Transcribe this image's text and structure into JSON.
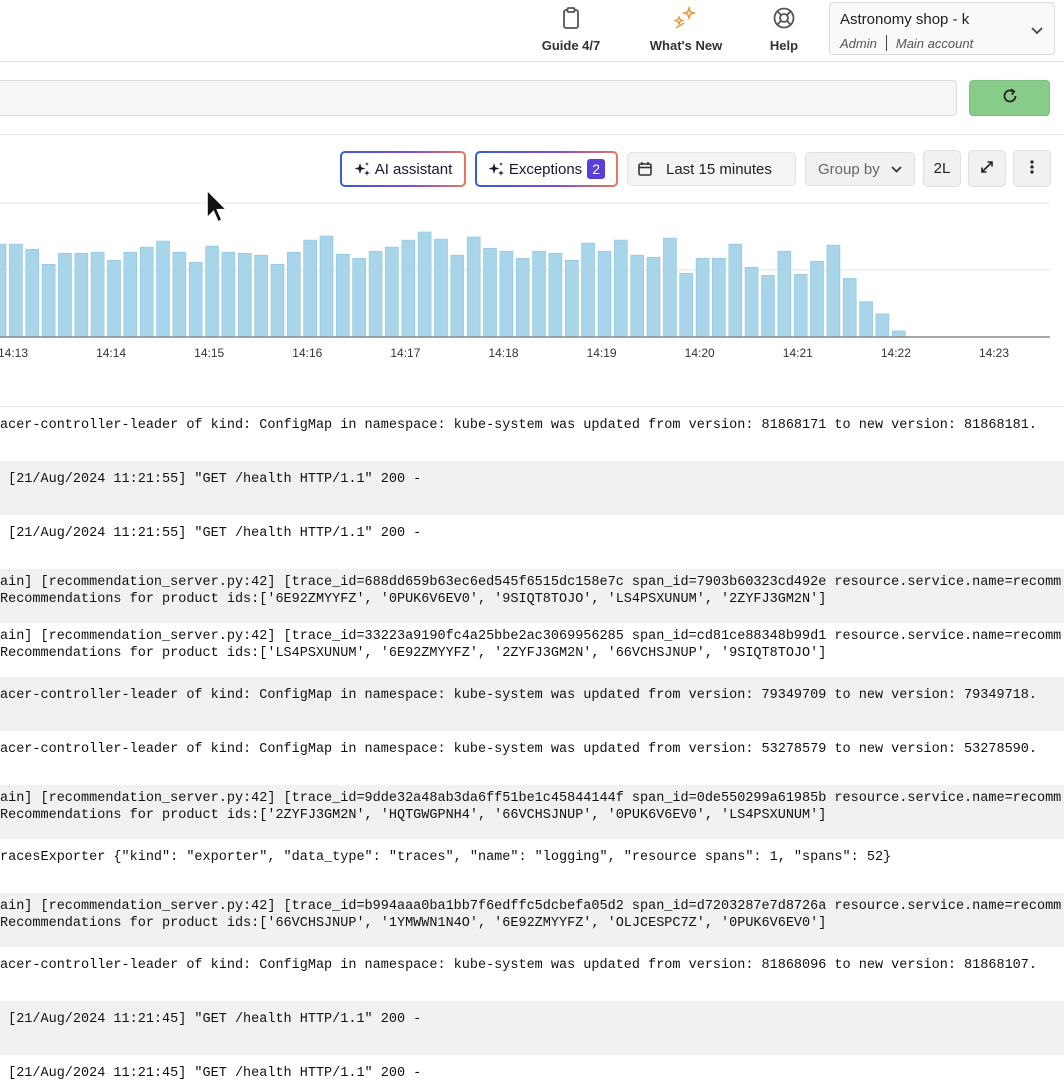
{
  "header": {
    "guide": {
      "label": "Guide 4/7",
      "icon": "clipboard-icon"
    },
    "whats_new": {
      "label": "What's New",
      "icon": "sparkle-stars-icon"
    },
    "help": {
      "label": "Help",
      "icon": "lifebuoy-icon"
    },
    "account": {
      "name": "Astronomy shop - k",
      "role": "Admin",
      "account": "Main account"
    }
  },
  "search": {
    "value": "",
    "refresh_icon": "refresh-icon",
    "refresh_color": "#88cc8a"
  },
  "toolbar": {
    "ai_assistant": "AI assistant",
    "exceptions": "Exceptions",
    "exceptions_count": "2",
    "time_range": "Last 15 minutes",
    "group_by": "Group by",
    "lines_toggle": "2L",
    "expand_icon": "expand-icon",
    "more_icon": "more-vertical-icon"
  },
  "chart_data": {
    "type": "bar",
    "color": "#a8d5ea",
    "x_tick_labels": [
      "14:13",
      "14:14",
      "14:15",
      "14:16",
      "14:17",
      "14:18",
      "14:19",
      "14:20",
      "14:21",
      "14:22",
      "14:23"
    ],
    "values": [
      92,
      92,
      87,
      72,
      83,
      83,
      84,
      76,
      84,
      89,
      95,
      84,
      74,
      90,
      84,
      83,
      81,
      72,
      84,
      96,
      100,
      82,
      78,
      85,
      89,
      96,
      104,
      97,
      81,
      99,
      88,
      85,
      78,
      85,
      83,
      76,
      93,
      85,
      96,
      81,
      79,
      98,
      63,
      78,
      78,
      92,
      69,
      61,
      85,
      62,
      75,
      91,
      58,
      35,
      23,
      6
    ],
    "ylabel": "",
    "xlabel": "",
    "grid": true,
    "legend": "none"
  },
  "logs": [
    {
      "lines": [
        "acer-controller-leader of kind: ConfigMap in namespace: kube-system was updated from version: 81868171 to new version: 81868181."
      ]
    },
    {
      "lines": [
        " [21/Aug/2024 11:21:55] \"GET /health HTTP/1.1\" 200 -"
      ]
    },
    {
      "lines": [
        " [21/Aug/2024 11:21:55] \"GET /health HTTP/1.1\" 200 -"
      ]
    },
    {
      "lines": [
        "ain] [recommendation_server.py:42] [trace_id=688dd659b63ec6ed545f6515dc158e7c span_id=7903b60323cd492e resource.service.name=recomm",
        "Recommendations for product ids:['6E92ZMYYFZ', '0PUK6V6EV0', '9SIQT8TOJO', 'LS4PSXUNUM', '2ZYFJ3GM2N']"
      ]
    },
    {
      "lines": [
        "ain] [recommendation_server.py:42] [trace_id=33223a9190fc4a25bbe2ac3069956285 span_id=cd81ce88348b99d1 resource.service.name=recomm",
        "Recommendations for product ids:['LS4PSXUNUM', '6E92ZMYYFZ', '2ZYFJ3GM2N', '66VCHSJNUP', '9SIQT8TOJO']"
      ]
    },
    {
      "lines": [
        "acer-controller-leader of kind: ConfigMap in namespace: kube-system was updated from version: 79349709 to new version: 79349718."
      ]
    },
    {
      "lines": [
        "acer-controller-leader of kind: ConfigMap in namespace: kube-system was updated from version: 53278579 to new version: 53278590."
      ]
    },
    {
      "lines": [
        "ain] [recommendation_server.py:42] [trace_id=9dde32a48ab3da6ff51be1c45844144f span_id=0de550299a61985b resource.service.name=recomm",
        "Recommendations for product ids:['2ZYFJ3GM2N', 'HQTGWGPNH4', '66VCHSJNUP', '0PUK6V6EV0', 'LS4PSXUNUM']"
      ]
    },
    {
      "lines": [
        "racesExporter {\"kind\": \"exporter\", \"data_type\": \"traces\", \"name\": \"logging\", \"resource spans\": 1, \"spans\": 52}"
      ]
    },
    {
      "lines": [
        "ain] [recommendation_server.py:42] [trace_id=b994aaa0ba1bb7f6edffc5dcbefa05d2 span_id=d7203287e7d8726a resource.service.name=recomm",
        "Recommendations for product ids:['66VCHSJNUP', '1YMWWN1N4O', '6E92ZMYYFZ', 'OLJCESPC7Z', '0PUK6V6EV0']"
      ]
    },
    {
      "lines": [
        "acer-controller-leader of kind: ConfigMap in namespace: kube-system was updated from version: 81868096 to new version: 81868107."
      ]
    },
    {
      "lines": [
        " [21/Aug/2024 11:21:45] \"GET /health HTTP/1.1\" 200 -"
      ]
    },
    {
      "lines": [
        " [21/Aug/2024 11:21:45] \"GET /health HTTP/1.1\" 200 -"
      ]
    }
  ]
}
